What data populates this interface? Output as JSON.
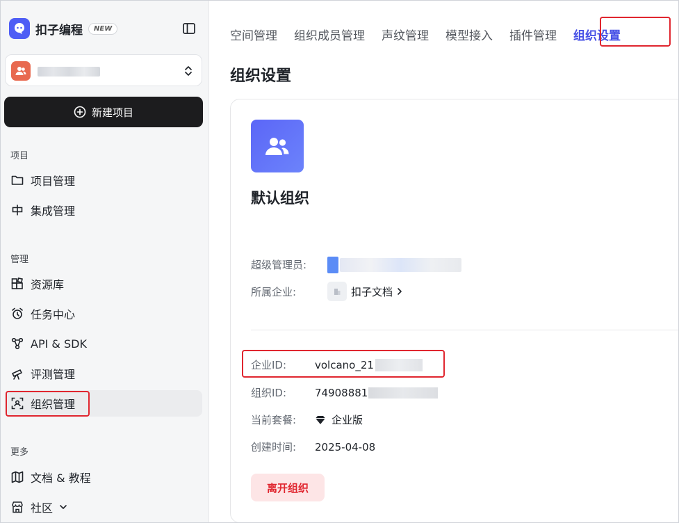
{
  "brand": {
    "name": "扣子编程",
    "badge": "NEW"
  },
  "sidebar": {
    "new_project": "新建项目",
    "sections": {
      "projects": "项目",
      "manage": "管理",
      "more": "更多"
    },
    "items": [
      {
        "label": "项目管理",
        "icon": "folder-icon"
      },
      {
        "label": "集成管理",
        "icon": "integration-icon"
      },
      {
        "label": "资源库",
        "icon": "library-icon"
      },
      {
        "label": "任务中心",
        "icon": "alarm-clock-icon"
      },
      {
        "label": "API & SDK",
        "icon": "api-nodes-icon"
      },
      {
        "label": "评测管理",
        "icon": "telescope-icon"
      },
      {
        "label": "组织管理",
        "icon": "org-scan-icon"
      },
      {
        "label": "文档 & 教程",
        "icon": "map-book-icon"
      },
      {
        "label": "社区",
        "icon": "store-icon"
      }
    ]
  },
  "tabs": [
    {
      "label": "空间管理"
    },
    {
      "label": "组织成员管理"
    },
    {
      "label": "声纹管理"
    },
    {
      "label": "模型接入"
    },
    {
      "label": "插件管理"
    },
    {
      "label": "组织设置",
      "active": true
    }
  ],
  "page": {
    "title": "组织设置",
    "org_name": "默认组织",
    "fields": {
      "super_admin_label": "超级管理员:",
      "enterprise_label": "所属企业:",
      "enterprise_value": "扣子文档",
      "enterprise_id_label": "企业ID:",
      "enterprise_id_value": "volcano_21",
      "org_id_label": "组织ID:",
      "org_id_value": "74908881",
      "plan_label": "当前套餐:",
      "plan_value": "企业版",
      "created_label": "创建时间:",
      "created_value": "2025-04-08"
    },
    "leave_button": "离开组织"
  },
  "colors": {
    "accent": "#4650e6",
    "highlight_box": "#e0262f",
    "danger_bg": "#fde5e6",
    "primary_button": "#1c1c1e",
    "org_avatar": "#e8694f"
  }
}
